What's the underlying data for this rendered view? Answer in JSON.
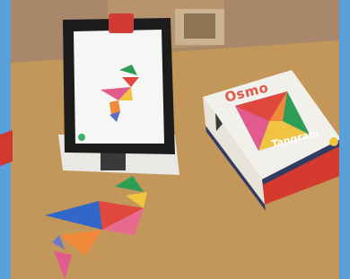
{
  "scene": {
    "description_free": true,
    "colors": {
      "sky_blue": "#5aa0d8",
      "table": "#c39659",
      "wall": "#a9876a",
      "tablet_body": "#1c1c1c",
      "red_reflector": "#d23a35",
      "box_white": "#f2f0ea",
      "box_red": "#d43a2e",
      "box_navy": "#2f3c66"
    },
    "box": {
      "logo": "Osmo",
      "product": "Tangram"
    }
  }
}
